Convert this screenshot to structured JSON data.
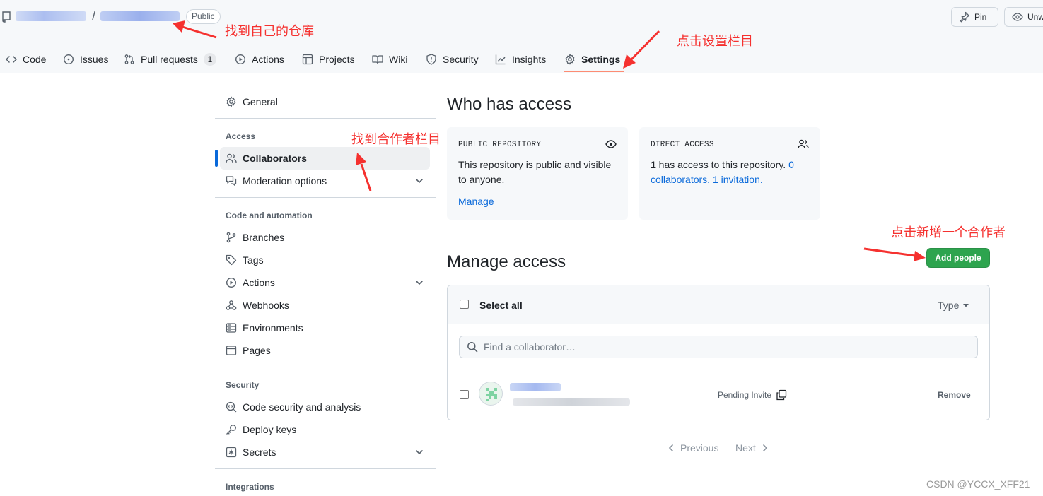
{
  "repo": {
    "visibility": "Public",
    "separator": "/"
  },
  "header_buttons": {
    "pin": "Pin",
    "unwatch": "Unw"
  },
  "tabs": [
    {
      "label": "Code",
      "icon": "code-icon"
    },
    {
      "label": "Issues",
      "icon": "issue-icon"
    },
    {
      "label": "Pull requests",
      "icon": "pull-request-icon",
      "count": "1"
    },
    {
      "label": "Actions",
      "icon": "play-icon"
    },
    {
      "label": "Projects",
      "icon": "table-icon"
    },
    {
      "label": "Wiki",
      "icon": "book-icon"
    },
    {
      "label": "Security",
      "icon": "shield-icon"
    },
    {
      "label": "Insights",
      "icon": "graph-icon"
    },
    {
      "label": "Settings",
      "icon": "gear-icon",
      "active": true
    }
  ],
  "sidebar": {
    "general": "General",
    "access_heading": "Access",
    "collaborators": "Collaborators",
    "moderation": "Moderation options",
    "code_heading": "Code and automation",
    "branches": "Branches",
    "tags": "Tags",
    "actions": "Actions",
    "webhooks": "Webhooks",
    "environments": "Environments",
    "pages": "Pages",
    "security_heading": "Security",
    "code_security": "Code security and analysis",
    "deploy_keys": "Deploy keys",
    "secrets": "Secrets",
    "integrations_heading": "Integrations"
  },
  "who_has_access": {
    "title": "Who has access",
    "public_card": {
      "title": "PUBLIC REPOSITORY",
      "text": "This repository is public and visible to anyone.",
      "link": "Manage"
    },
    "direct_card": {
      "title": "DIRECT ACCESS",
      "count": "1",
      "text": " has access to this repository. ",
      "collaborators_link": "0 collaborators.",
      "invitation_link": "1 invitation."
    }
  },
  "manage_access": {
    "title": "Manage access",
    "add_button": "Add people",
    "select_all": "Select all",
    "type_filter": "Type",
    "search_placeholder": "Find a collaborator…",
    "row": {
      "status": "Pending Invite",
      "remove": "Remove"
    }
  },
  "pagination": {
    "previous": "Previous",
    "next": "Next"
  },
  "annotations": {
    "find_repo": "找到自己的仓库",
    "click_settings": "点击设置栏目",
    "find_collaborators": "找到合作者栏目",
    "click_add": "点击新增一个合作者"
  },
  "watermark": "CSDN @YCCX_XFF21",
  "colors": {
    "accent_blue": "#0969da",
    "green_button": "#2da44e",
    "annotation_red": "#f5312f",
    "tab_underline": "#fd8c73"
  }
}
